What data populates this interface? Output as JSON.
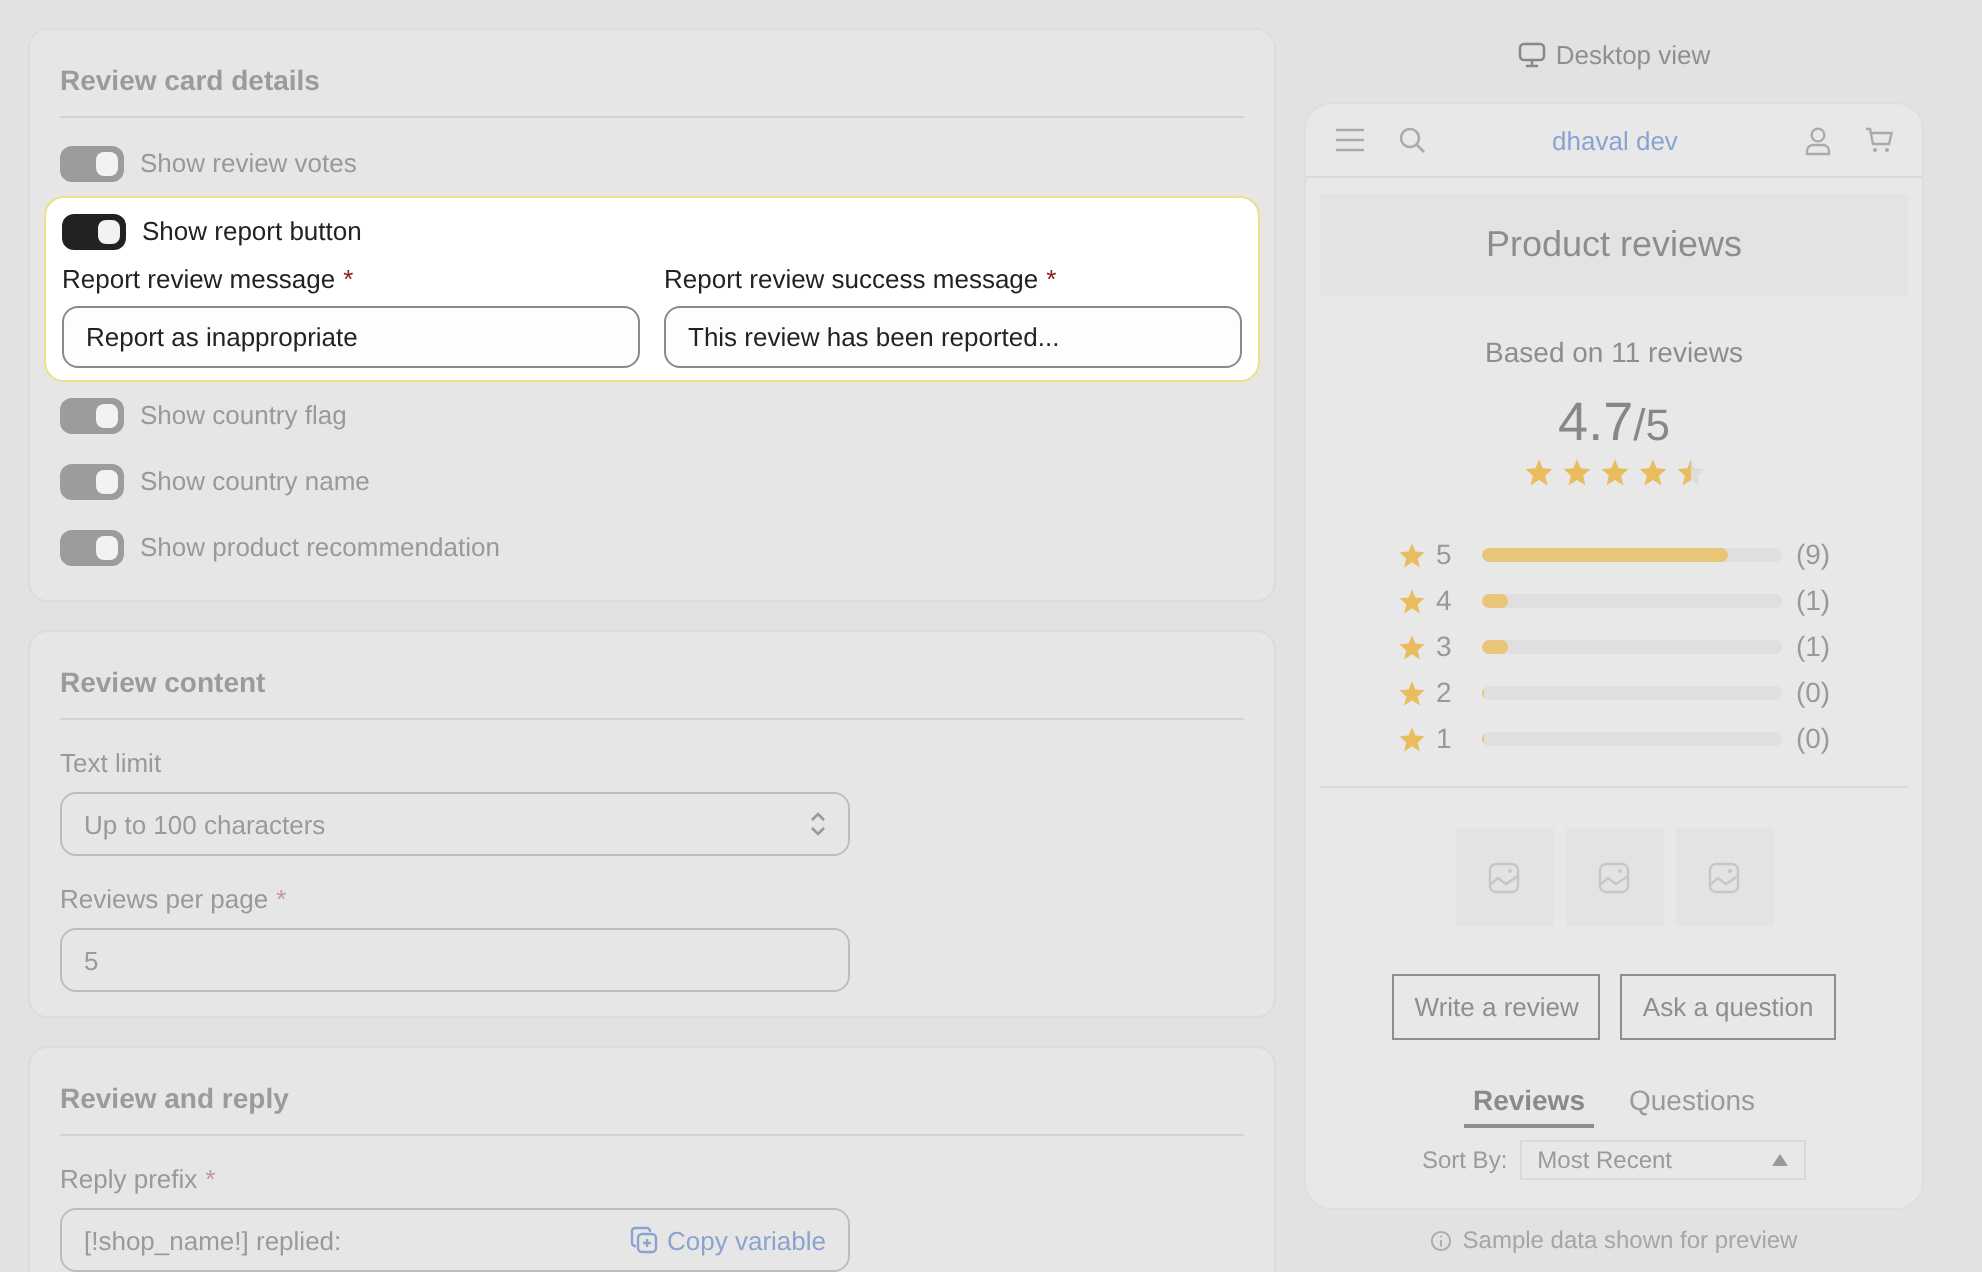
{
  "sections": [
    {
      "title": "Review card details",
      "items": [
        {
          "kind": "toggle",
          "label": "Show review votes",
          "on": true,
          "focused": false
        },
        {
          "kind": "toggle_group",
          "label": "Show report button",
          "on": true,
          "focused": true,
          "fields": [
            {
              "label": "Report review message",
              "required_mark": "*",
              "value": "Report as inappropriate"
            },
            {
              "label": "Report review success message",
              "required_mark": "*",
              "value": "This review has been reported..."
            }
          ]
        },
        {
          "kind": "toggle",
          "label": "Show country flag",
          "on": true,
          "focused": false
        },
        {
          "kind": "toggle",
          "label": "Show country name",
          "on": true,
          "focused": false
        },
        {
          "kind": "toggle",
          "label": "Show product recommendation",
          "on": true,
          "focused": false
        }
      ]
    },
    {
      "title": "Review content",
      "items": [
        {
          "kind": "select",
          "label": "Text limit",
          "value": "Up to 100 characters"
        },
        {
          "kind": "text",
          "label": "Reviews per page",
          "required_mark": "*",
          "value": "5"
        }
      ]
    },
    {
      "title": "Review and reply",
      "items": [
        {
          "kind": "variable",
          "label": "Reply prefix",
          "required_mark": "*",
          "value": "[!shop_name!] replied:",
          "action": "Copy variable"
        }
      ]
    }
  ],
  "preview": {
    "view_toggle": "Desktop view",
    "store_name": "dhaval dev",
    "title": "Product reviews",
    "summary": "Based on 11 reviews",
    "score": "4.7",
    "score_max": "/5",
    "stars": 4.5,
    "histogram": [
      {
        "label": "5",
        "level": 0.82,
        "count": "(9)"
      },
      {
        "label": "4",
        "level": 0.09,
        "count": "(1)"
      },
      {
        "label": "3",
        "level": 0.09,
        "count": "(1)"
      },
      {
        "label": "2",
        "level": 0,
        "count": "(0)"
      },
      {
        "label": "1",
        "level": 0,
        "count": "(0)"
      }
    ],
    "buttons": [
      "Write a review",
      "Ask a question"
    ],
    "tabs": [
      {
        "label": "Reviews",
        "selected": true
      },
      {
        "label": "Questions",
        "selected": false
      }
    ],
    "sort": {
      "label": "Sort By:",
      "value": "Most Recent"
    },
    "footnote": "Sample data shown for preview"
  }
}
